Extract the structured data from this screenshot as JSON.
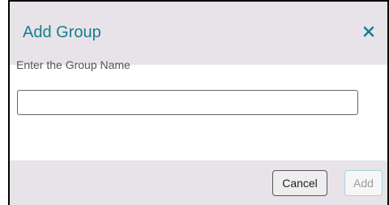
{
  "dialog": {
    "title": "Add Group",
    "field_label": "Enter the Group Name",
    "input": {
      "value": "",
      "placeholder": ""
    },
    "buttons": {
      "cancel_label": "Cancel",
      "add_label": "Add"
    },
    "icons": {
      "close": "close-icon"
    },
    "colors": {
      "accent": "#137f93",
      "header_bg": "#e8e3e8",
      "footer_bg": "#e8e3e8",
      "add_disabled_text": "#9c9c9c"
    }
  }
}
